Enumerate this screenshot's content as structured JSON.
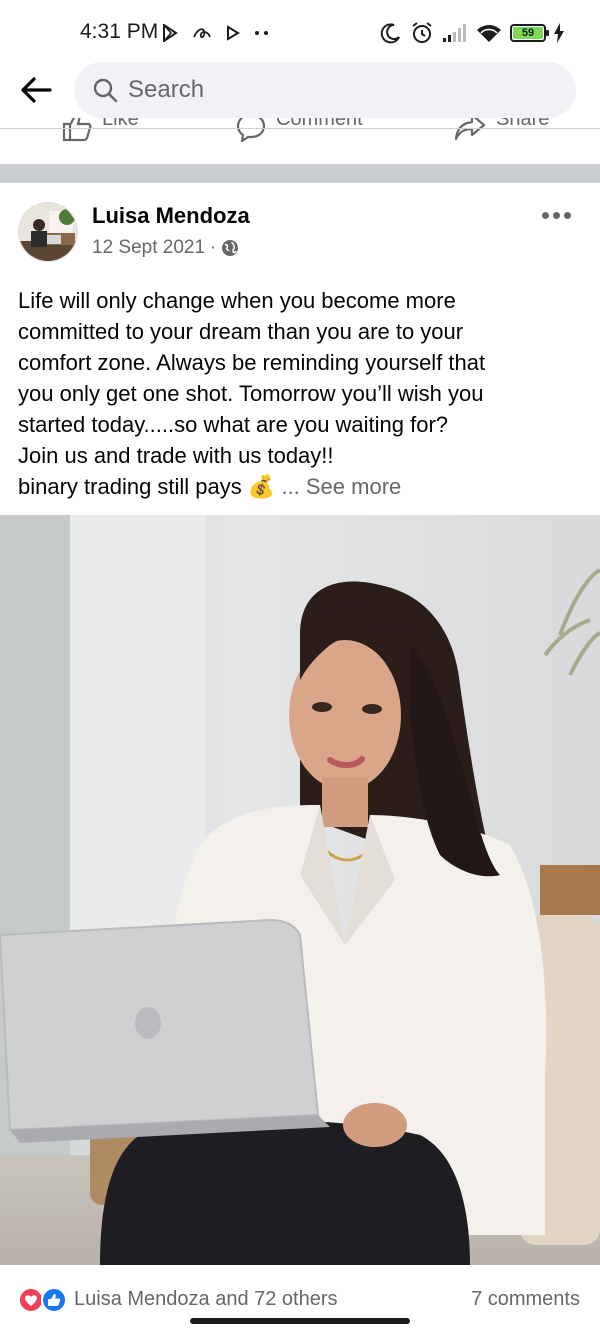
{
  "status_bar": {
    "time": "4:31 PM",
    "battery_level": "59",
    "icons": [
      "play-store-icon",
      "cursive-app-icon",
      "play-arrow-icon",
      "more-dots-icon",
      "moon-icon",
      "alarm-icon",
      "signal-icon",
      "wifi-icon",
      "battery-icon",
      "charging-bolt-icon"
    ]
  },
  "header": {
    "back_icon": "back-arrow-icon",
    "search_placeholder": "Search"
  },
  "previous_post_actions": [
    {
      "label": "Like",
      "icon": "thumbs-up-icon"
    },
    {
      "label": "Comment",
      "icon": "comment-bubble-icon"
    },
    {
      "label": "Share",
      "icon": "share-arrow-icon"
    }
  ],
  "post": {
    "author": "Luisa Mendoza",
    "date": "12 Sept 2021",
    "privacy_icon": "globe-icon",
    "text_lines": [
      "Life will only change when you become more",
      "committed to your dream than you are to your",
      "comfort zone. Always be reminding yourself that",
      "you only get one shot. Tomorrow you’ll wish you",
      "started today.....so what are you waiting for?",
      "Join us and trade with us today!!",
      "binary trading still pays"
    ],
    "emoji": "💰",
    "see_more": "... See more",
    "reactions_text": "Luisa Mendoza and 72 others",
    "comments_text": "7 comments",
    "colors": {
      "like_blue": "#1877f2",
      "love_red": "#f33e58",
      "secondary_text": "#65676b"
    }
  }
}
